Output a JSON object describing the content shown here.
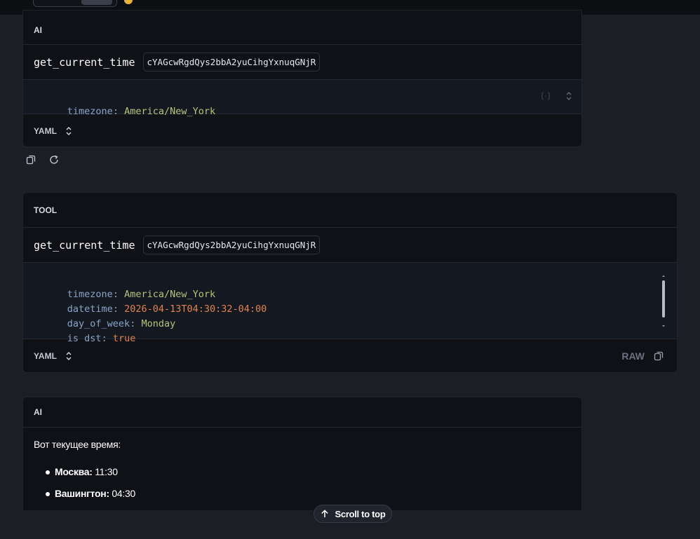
{
  "messages": [
    {
      "role_label": "AI",
      "call": {
        "function": "get_current_time",
        "call_id": "cYAGcwRgdQys2bbA2yuCihgYxnuqGNjR"
      },
      "args": [
        {
          "key": "timezone",
          "value": "America/New_York"
        }
      ],
      "format_label": "YAML"
    },
    {
      "role_label": "TOOL",
      "call": {
        "function": "get_current_time",
        "call_id": "cYAGcwRgdQys2bbA2yuCihgYxnuqGNjR"
      },
      "result": [
        {
          "key": "timezone",
          "value": "America/New_York"
        },
        {
          "key": "datetime",
          "value": "2026-04-13T04:30:32-04:00"
        },
        {
          "key": "day_of_week",
          "value": "Monday"
        },
        {
          "key": "is dst",
          "value": "true"
        }
      ],
      "format_label": "YAML",
      "raw_label": "RAW"
    },
    {
      "role_label": "AI",
      "intro": "Вот текущее время:",
      "bullets": [
        {
          "city": "Москва:",
          "time": "11:30"
        },
        {
          "city": "Вашингтон:",
          "time": "04:30"
        }
      ]
    }
  ],
  "scroll_to_top_label": "Scroll to top",
  "colors": {
    "background": "#1b1e25",
    "card": "#0f1117",
    "code_bg": "#141821",
    "key": "#8aa3c7",
    "string": "#b7c27a",
    "number": "#e1824f"
  }
}
